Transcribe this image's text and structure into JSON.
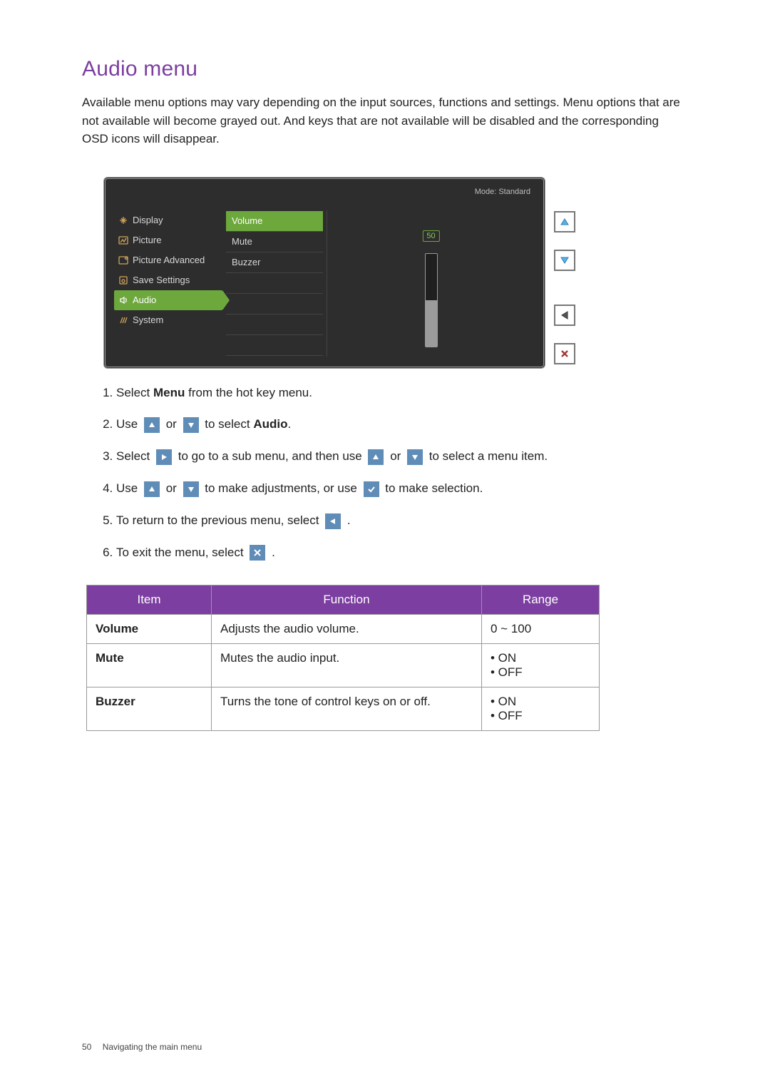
{
  "heading": "Audio menu",
  "intro": "Available menu options may vary depending on the input sources, functions and settings. Menu options that are not available will become grayed out. And keys that are not available will be disabled and the corresponding OSD icons will disappear.",
  "osd": {
    "mode_label": "Mode: Standard",
    "menu_items": [
      "Display",
      "Picture",
      "Picture Advanced",
      "Save Settings",
      "Audio",
      "System"
    ],
    "selected_menu_index": 4,
    "options": [
      "Volume",
      "Mute",
      "Buzzer"
    ],
    "selected_option_index": 0,
    "value": "50"
  },
  "steps": {
    "s1a": "Select ",
    "s1b": "Menu",
    "s1c": " from the hot key menu.",
    "s2a": "Use ",
    "s2b": " or ",
    "s2c": " to select ",
    "s2d": "Audio",
    "s2e": ".",
    "s3a": "Select ",
    "s3b": " to go to a sub menu, and then use ",
    "s3c": " or ",
    "s3d": " to select a menu item.",
    "s4a": "Use ",
    "s4b": " or ",
    "s4c": " to make adjustments, or use ",
    "s4d": " to make selection.",
    "s5a": "To return to the previous menu, select ",
    "s5b": ".",
    "s6a": "To exit the menu, select ",
    "s6b": "."
  },
  "table": {
    "headers": [
      "Item",
      "Function",
      "Range"
    ],
    "rows": [
      {
        "item": "Volume",
        "func": "Adjusts the audio volume.",
        "range": [
          "0 ~ 100"
        ]
      },
      {
        "item": "Mute",
        "func": "Mutes the audio input.",
        "range": [
          "• ON",
          "• OFF"
        ]
      },
      {
        "item": "Buzzer",
        "func": "Turns the tone of control keys on or off.",
        "range": [
          "• ON",
          "• OFF"
        ]
      }
    ]
  },
  "footer": {
    "page": "50",
    "section": "Navigating the main menu"
  }
}
